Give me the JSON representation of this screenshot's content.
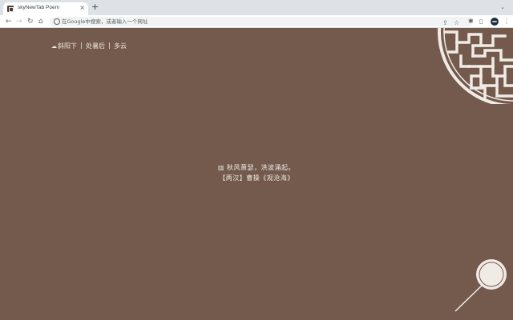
{
  "browser": {
    "tab_title": "skyNewTab Poem",
    "tab_close": "×",
    "new_tab": "+",
    "tabs_menu": "⌄",
    "omnibox_placeholder": "在Google中搜索，或者输入一个网址"
  },
  "weather": {
    "icon": "cloud-icon",
    "location": "斜阳下",
    "time": "处暑后",
    "condition": "多云"
  },
  "poem": {
    "line": "秋风萧瑟，洪波涌起。",
    "source": "【两汉】曹操《观沧海》"
  },
  "colors": {
    "background": "#735a4d",
    "ornament": "#f1ebe6"
  }
}
